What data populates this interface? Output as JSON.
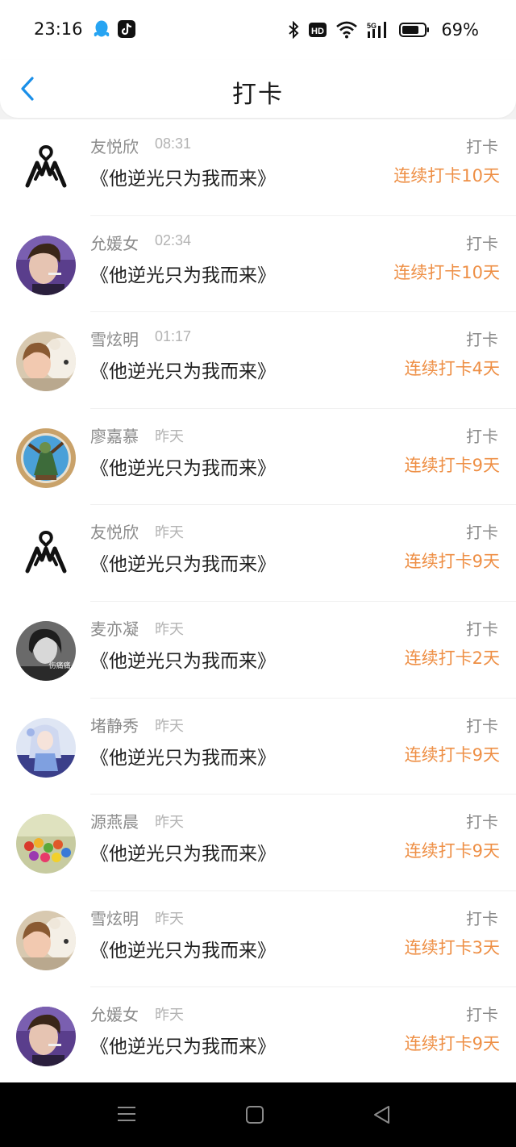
{
  "status_bar": {
    "time": "23:16",
    "battery_percent": "69%",
    "icons": [
      "qq-icon",
      "tiktok-icon",
      "bluetooth-icon",
      "hd-icon",
      "wifi-icon",
      "5g-signal-icon",
      "battery-icon"
    ]
  },
  "header": {
    "title": "打卡",
    "back_icon": "chevron-left-icon"
  },
  "colors": {
    "accent_back": "#1a8fe8",
    "streak_orange": "#ee8f45",
    "name_gray": "#8a8a8a",
    "time_gray": "#b3b3b3"
  },
  "entries": [
    {
      "name": "友悦欣",
      "time": "08:31",
      "book": "《他逆光只为我而来》",
      "action": "打卡",
      "streak": "连续打卡10天",
      "avatar": "logo"
    },
    {
      "name": "允媛女",
      "time": "02:34",
      "book": "《他逆光只为我而来》",
      "action": "打卡",
      "streak": "连续打卡10天",
      "avatar": "photo-boy"
    },
    {
      "name": "雪炫明",
      "time": "01:17",
      "book": "《他逆光只为我而来》",
      "action": "打卡",
      "streak": "连续打卡4天",
      "avatar": "photo-girl-bear"
    },
    {
      "name": "廖嘉慕",
      "time": "昨天",
      "book": "《他逆光只为我而来》",
      "action": "打卡",
      "streak": "连续打卡9天",
      "avatar": "photo-game-hero"
    },
    {
      "name": "友悦欣",
      "time": "昨天",
      "book": "《他逆光只为我而来》",
      "action": "打卡",
      "streak": "连续打卡9天",
      "avatar": "logo"
    },
    {
      "name": "麦亦凝",
      "time": "昨天",
      "book": "《他逆光只为我而来》",
      "action": "打卡",
      "streak": "连续打卡2天",
      "avatar": "photo-bw-girl",
      "avatar_text": "伤痛痛"
    },
    {
      "name": "堵静秀",
      "time": "昨天",
      "book": "《他逆光只为我而来》",
      "action": "打卡",
      "streak": "连续打卡9天",
      "avatar": "photo-anime"
    },
    {
      "name": "源燕晨",
      "time": "昨天",
      "book": "《他逆光只为我而来》",
      "action": "打卡",
      "streak": "连续打卡9天",
      "avatar": "photo-candy"
    },
    {
      "name": "雪炫明",
      "time": "昨天",
      "book": "《他逆光只为我而来》",
      "action": "打卡",
      "streak": "连续打卡3天",
      "avatar": "photo-girl-bear"
    },
    {
      "name": "允媛女",
      "time": "昨天",
      "book": "《他逆光只为我而来》",
      "action": "打卡",
      "streak": "连续打卡9天",
      "avatar": "photo-boy"
    }
  ],
  "nav_bar": {
    "icons": [
      "menu-icon",
      "home-icon",
      "back-triangle-icon"
    ]
  }
}
